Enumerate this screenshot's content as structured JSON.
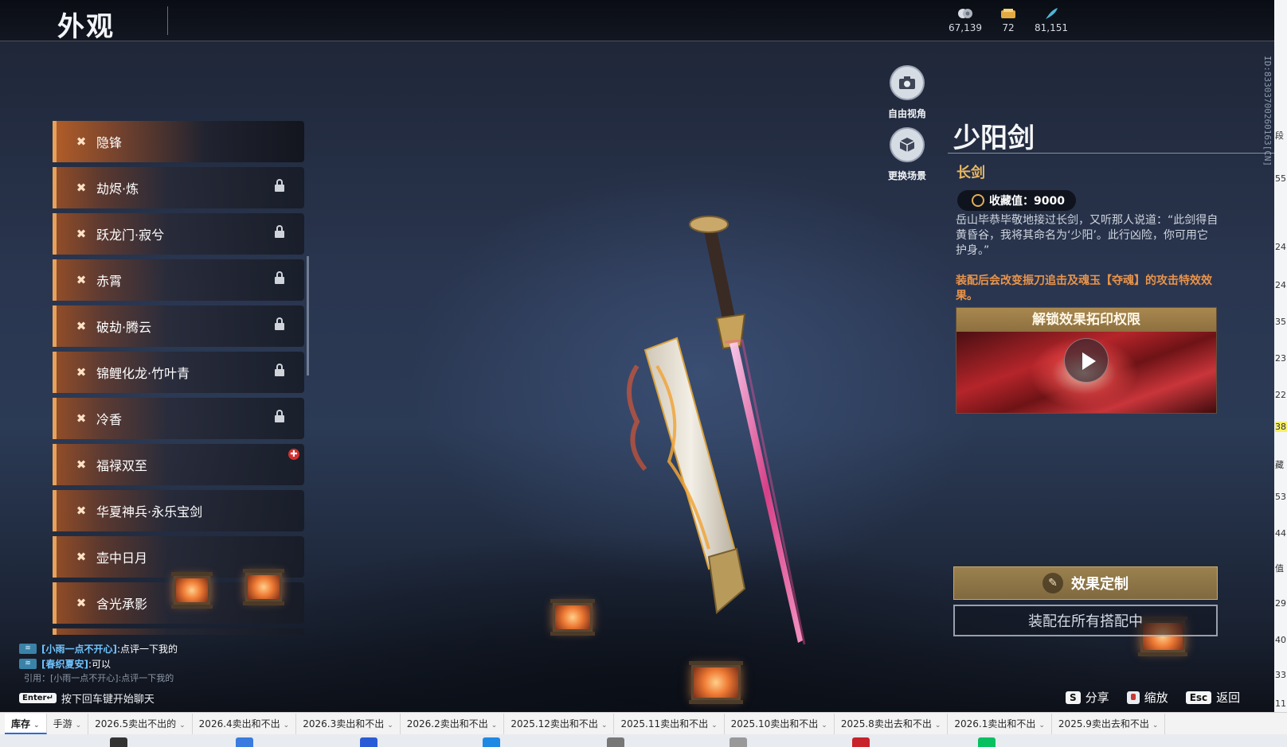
{
  "header": {
    "title": "外观",
    "currencies": [
      {
        "icon": "coin-stack-icon",
        "value": "67,139"
      },
      {
        "icon": "ticket-icon",
        "value": "72"
      },
      {
        "icon": "feather-icon",
        "value": "81,151"
      }
    ]
  },
  "side_id": "ID:83303700260163[CN]",
  "skins": [
    {
      "label": "隐锋",
      "locked": false
    },
    {
      "label": "劫烬·炼",
      "locked": true
    },
    {
      "label": "跃龙门·寂兮",
      "locked": true
    },
    {
      "label": "赤霄",
      "locked": true
    },
    {
      "label": "破劫·腾云",
      "locked": true
    },
    {
      "label": "锦鲤化龙·竹叶青",
      "locked": true
    },
    {
      "label": "冷香",
      "locked": true
    },
    {
      "label": "福禄双至",
      "locked": false
    },
    {
      "label": "华夏神兵·永乐宝剑",
      "locked": false
    },
    {
      "label": "壶中日月",
      "locked": false
    },
    {
      "label": "含光承影",
      "locked": false
    }
  ],
  "tools": {
    "free_view": "自由视角",
    "change_scene": "更换场景"
  },
  "weapon": {
    "name": "少阳剑",
    "type": "长剑",
    "collection_label": "收藏值：9000",
    "description": "岳山毕恭毕敬地接过长剑，又听那人说道：“此剑得自黄昏谷，我将其命名为‘少阳’。此行凶险，你可用它护身。”",
    "effect_note": "装配后会改变振刀追击及魂玉【夺魂】的攻击特效效果。",
    "video_title": "解锁效果拓印权限"
  },
  "buttons": {
    "customize": "效果定制",
    "equip_all": "装配在所有搭配中"
  },
  "chat": {
    "lines": [
      {
        "user": "[小雨一点不开心]",
        "text": ":点评一下我的"
      },
      {
        "user": "[春织夏安]",
        "text": ":可以"
      }
    ],
    "quote": "引用：[小雨一点不开心]:点评一下我的",
    "enter_key": "Enter↵",
    "hint": "按下回车键开始聊天"
  },
  "hints": [
    {
      "key": "S",
      "label": "分享"
    },
    {
      "key": "",
      "label": "缩放"
    },
    {
      "key": "Esc",
      "label": "返回"
    }
  ],
  "edge_numbers": [
    "55",
    "段",
    "24",
    "24",
    "35",
    "23",
    "22",
    "38",
    "藏",
    "53",
    "44",
    "值",
    "29",
    "40",
    "33",
    "11"
  ],
  "sheet_tabs": [
    "库存",
    "手游",
    "2026.5卖出不出的",
    "2026.4卖出和不出",
    "2026.3卖出和不出",
    "2026.2卖出和不出",
    "2025.12卖出和不出",
    "2025.11卖出和不出",
    "2025.10卖出和不出",
    "2025.8卖出去和不出",
    "2026.1卖出和不出",
    "2025.9卖出去和不出"
  ],
  "colors": {
    "accent_orange": "#e6a15c",
    "type_gold": "#e8b764",
    "effect_orange": "#e9934a",
    "chat_name_blue": "#6fc4ff"
  }
}
